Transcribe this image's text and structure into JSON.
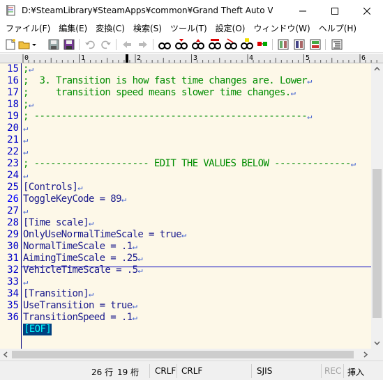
{
  "window": {
    "title": "D:¥SteamLibrary¥SteamApps¥common¥Grand Theft Auto V¥SlowMoti...",
    "minimize_glyph": "—",
    "maximize_glyph": "☐",
    "close_glyph": "✕"
  },
  "menu": [
    "ファイル(F)",
    "編集(E)",
    "変換(C)",
    "検索(S)",
    "ツール(T)",
    "設定(O)",
    "ウィンドウ(W)",
    "ヘルプ(H)"
  ],
  "ruler": {
    "labels": [
      "0",
      "1",
      "2",
      "3",
      "4",
      "5",
      "6"
    ]
  },
  "editor": {
    "lines": [
      {
        "num": "15",
        "text": ";",
        "kind": "comment"
      },
      {
        "num": "16",
        "text": ";  3. Transition is how fast time changes are. Lower",
        "kind": "comment"
      },
      {
        "num": "17",
        "text": ";     transition speed means slower time changes.",
        "kind": "comment"
      },
      {
        "num": "18",
        "text": ";",
        "kind": "comment"
      },
      {
        "num": "19",
        "text": "; --------------------------------------------------",
        "kind": "comment"
      },
      {
        "num": "20",
        "text": "",
        "kind": "text"
      },
      {
        "num": "21",
        "text": "",
        "kind": "text"
      },
      {
        "num": "22",
        "text": "",
        "kind": "text"
      },
      {
        "num": "23",
        "text": "; --------------------- EDIT THE VALUES BELOW --------------",
        "kind": "comment"
      },
      {
        "num": "24",
        "text": "",
        "kind": "text"
      },
      {
        "num": "25",
        "text": "[Controls]",
        "kind": "text"
      },
      {
        "num": "26",
        "text": "ToggleKeyCode = 89",
        "kind": "text"
      },
      {
        "num": "27",
        "text": "",
        "kind": "text"
      },
      {
        "num": "28",
        "text": "[Time scale]",
        "kind": "text"
      },
      {
        "num": "29",
        "text": "OnlyUseNormalTimeScale = true",
        "kind": "text"
      },
      {
        "num": "30",
        "text": "NormalTimeScale = .1",
        "kind": "text"
      },
      {
        "num": "31",
        "text": "AimingTimeScale = .25",
        "kind": "text"
      },
      {
        "num": "32",
        "text": "VehicleTimeScale = .5",
        "kind": "text"
      },
      {
        "num": "33",
        "text": "",
        "kind": "text"
      },
      {
        "num": "34",
        "text": "[Transition]",
        "kind": "text"
      },
      {
        "num": "35",
        "text": "UseTransition = true",
        "kind": "text"
      },
      {
        "num": "36",
        "text": "TransitionSpeed = .1",
        "kind": "text"
      }
    ],
    "eof_marker": "[EOF]",
    "newline_glyph": "↵"
  },
  "status": {
    "line": "26 行",
    "col": "19 桁",
    "eol1": "CRLF",
    "eol2": "CRLF",
    "encoding": "SJIS",
    "rec": "REC",
    "mode": "挿入"
  },
  "colors": {
    "editor_bg": "#fdf8e8",
    "comment": "#008c00",
    "text": "#1a1a8c",
    "line_number": "#0000c8"
  }
}
